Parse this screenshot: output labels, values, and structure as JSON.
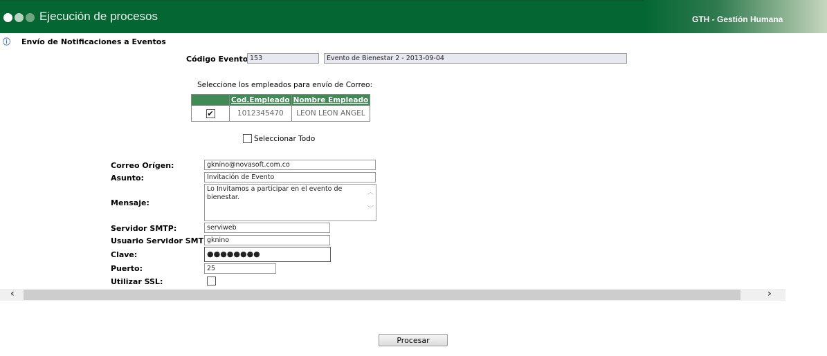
{
  "header": {
    "title": "Ejecución de procesos",
    "brand": "GTH - Gestión Humana"
  },
  "section": {
    "title": "Envío de Notificaciones a Eventos",
    "icon": "info-icon"
  },
  "evento": {
    "label": "Código Evento:",
    "code": "153",
    "name": "Evento de Bienestar 2 - 2013-09-04"
  },
  "employees": {
    "caption": "Seleccione los empleados para envío de Correo:",
    "columns": [
      "",
      "Cod.Empleado",
      "Nombre Empleado"
    ],
    "rows": [
      {
        "checked": true,
        "code": "1012345470",
        "name": "LEON LEON ANGEL"
      }
    ],
    "select_all": "Seleccionar Todo"
  },
  "form": {
    "correo": {
      "label": "Correo Orígen:",
      "value": "gknino@novasoft.com.co"
    },
    "asunto": {
      "label": "Asunto:",
      "value": "Invitación de Evento"
    },
    "mensaje": {
      "label": "Mensaje:",
      "value": "Lo Invitamos a participar en el evento de bienestar."
    },
    "smtp": {
      "label": "Servidor SMTP:",
      "value": "serviweb"
    },
    "usuario": {
      "label": "Usuario Servidor SMTP:",
      "value": "gknino"
    },
    "clave": {
      "label": "Clave:",
      "value": "●●●●●●●●"
    },
    "puerto": {
      "label": "Puerto:",
      "value": "25"
    },
    "ssl": {
      "label": "Utilizar SSL:",
      "checked": false
    }
  },
  "buttons": {
    "procesar": "Procesar"
  },
  "colors": {
    "header": "#046633",
    "table_header": "#3f8a55"
  }
}
